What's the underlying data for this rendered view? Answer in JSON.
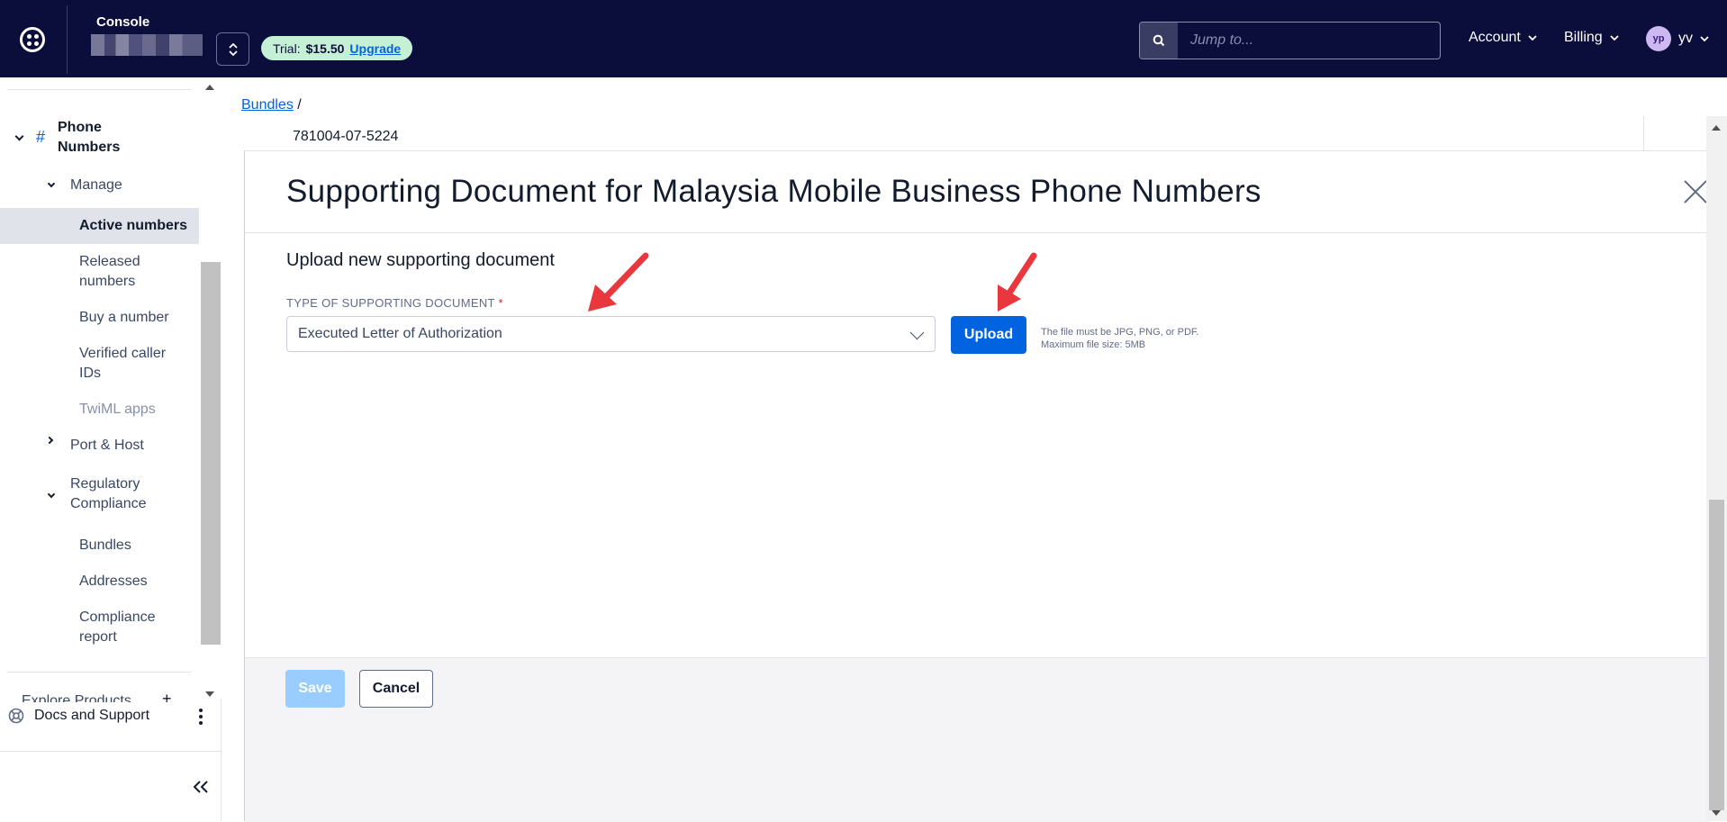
{
  "header": {
    "console_label": "Console",
    "trial_label": "Trial:",
    "trial_amount": "$15.50",
    "upgrade_label": "Upgrade",
    "search_placeholder": "Jump to...",
    "account_label": "Account",
    "billing_label": "Billing",
    "avatar_initials": "yp",
    "user_label": "yv"
  },
  "sidebar": {
    "section": "Phone Numbers",
    "manage": "Manage",
    "active_numbers": "Active numbers",
    "released_numbers": "Released numbers",
    "buy_a_number": "Buy a number",
    "verified_caller_ids": "Verified caller IDs",
    "twiml_apps": "TwiML apps",
    "port_host": "Port & Host",
    "regulatory_compliance": "Regulatory Compliance",
    "bundles": "Bundles",
    "addresses": "Addresses",
    "compliance_report": "Compliance report",
    "explore_products": "Explore Products",
    "docs_support": "Docs and Support"
  },
  "main": {
    "breadcrumb_bundles": "Bundles",
    "breadcrumb_sep": "/",
    "background_value": "781004-07-5224"
  },
  "modal": {
    "title": "Supporting Document for Malaysia Mobile Business Phone Numbers",
    "section_title": "Upload new supporting document",
    "field_label": "TYPE OF SUPPORTING DOCUMENT",
    "required_mark": "*",
    "selected_type": "Executed Letter of Authorization",
    "upload_label": "Upload",
    "hint": "The file must be JPG, PNG, or PDF. Maximum file size: 5MB",
    "save_label": "Save",
    "cancel_label": "Cancel"
  },
  "colors": {
    "topbar": "#0b0d3b",
    "primary": "#0263e0",
    "save_disabled": "#99cdff",
    "trial_badge": "#c6f0d5",
    "annotation_arrow": "#e8383d"
  }
}
